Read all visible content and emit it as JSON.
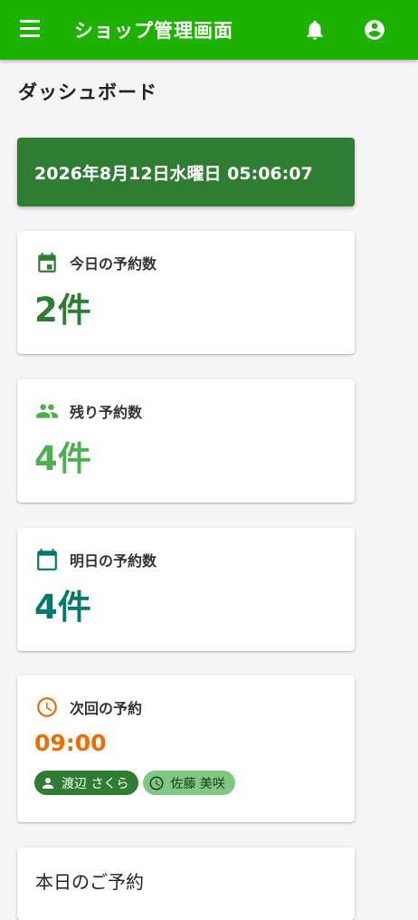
{
  "header": {
    "title": "ショップ管理画面"
  },
  "page_title": "ダッシュボード",
  "datetime": "2026年8月12日水曜日 05:06:07",
  "cards": {
    "today": {
      "label": "今日の予約数",
      "value": "2件",
      "color": "#2e7d32",
      "icon": "calendar-today-icon"
    },
    "remaining": {
      "label": "残り予約数",
      "value": "4件",
      "color": "#4caf50",
      "icon": "people-icon"
    },
    "tomorrow": {
      "label": "明日の予約数",
      "value": "4件",
      "color": "#00796b",
      "icon": "calendar-icon"
    },
    "next": {
      "label": "次回の予約",
      "time": "09:00",
      "color": "#ef6c00",
      "icon": "clock-icon",
      "chips": [
        {
          "text": "渡辺 さくら",
          "icon": "person-icon"
        },
        {
          "text": "佐藤 美咲",
          "icon": "clock-icon"
        }
      ]
    }
  },
  "today_reservations": {
    "title": "本日のご予約"
  },
  "colors": {
    "appbar": "#1db100",
    "date_banner": "#2e7d32"
  }
}
